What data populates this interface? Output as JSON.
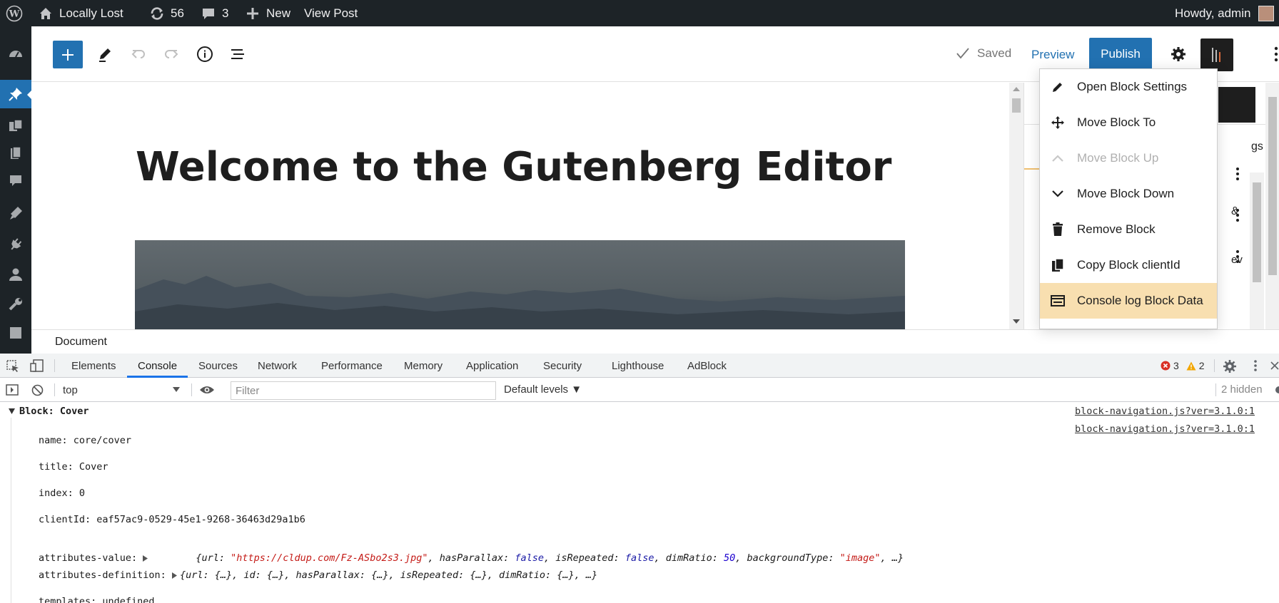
{
  "adminbar": {
    "site_name": "Locally Lost",
    "updates_count": "56",
    "comments_count": "3",
    "new_label": "New",
    "view_post_label": "View Post",
    "howdy": "Howdy, admin"
  },
  "editor": {
    "status_saved": "Saved",
    "preview_label": "Preview",
    "publish_label": "Publish",
    "post_title": "Welcome to the Gutenberg Editor",
    "breadcrumb": "Document"
  },
  "sidebar_fragments": {
    "tab_fragment": "gs",
    "row1_fragment": "",
    "row2_fragment": "&",
    "row3_fragment": "ev"
  },
  "block_menu": {
    "items": [
      {
        "label": "Open Block Settings",
        "icon": "pencil-icon",
        "state": "normal"
      },
      {
        "label": "Move Block To",
        "icon": "move-icon",
        "state": "normal"
      },
      {
        "label": "Move Block Up",
        "icon": "chevron-up-icon",
        "state": "disabled"
      },
      {
        "label": "Move Block Down",
        "icon": "chevron-down-icon",
        "state": "normal"
      },
      {
        "label": "Remove Block",
        "icon": "trash-icon",
        "state": "normal"
      },
      {
        "label": "Copy Block clientId",
        "icon": "copy-icon",
        "state": "normal"
      },
      {
        "label": "Console log Block Data",
        "icon": "console-icon",
        "state": "highlighted"
      }
    ]
  },
  "devtools": {
    "tabs": [
      "Elements",
      "Console",
      "Sources",
      "Network",
      "Performance",
      "Memory",
      "Application",
      "Security",
      "Lighthouse",
      "AdBlock"
    ],
    "active_tab": "Console",
    "errors_count": "3",
    "warnings_count": "2",
    "context": "top",
    "filter_placeholder": "Filter",
    "levels_label": "Default levels ▼",
    "hidden_count": "2 hidden",
    "console": {
      "group_label": "Block: Cover",
      "source": "block-navigation.js?ver=3.1.0:1",
      "source2": "block-navigation.js?ver=3.1.0:1",
      "name_line": "name: core/cover",
      "title_line": "title: Cover",
      "index_line": "index: 0",
      "clientid_line": "clientId: eaf57ac9-0529-45e1-9268-36463d29a1b6",
      "attr_value_key": "attributes-value: ",
      "attr_value_url_key": "{url: ",
      "attr_value_url": "\"https://cldup.com/Fz-ASbo2s3.jpg\"",
      "attr_value_parallax_key": ", hasParallax: ",
      "attr_value_parallax": "false",
      "attr_value_repeated_key": ", isRepeated: ",
      "attr_value_repeated": "false",
      "attr_value_dim_key": ", dimRatio: ",
      "attr_value_dim": "50",
      "attr_value_bgtype_key": ", backgroundType: ",
      "attr_value_bgtype": "\"image\"",
      "attr_value_tail": ", …}",
      "attr_def_key": "attributes-definition: ",
      "attr_def_value": "{url: {…}, id: {…}, hasParallax: {…}, isRepeated: {…}, dimRatio: {…}, …}",
      "partial_line": "templates: undefined"
    }
  },
  "colors": {
    "admin_dark": "#1d2327",
    "accent_blue": "#2271b1",
    "highlight": "#f8dfb0",
    "devtools_blue": "#1a73e8"
  }
}
